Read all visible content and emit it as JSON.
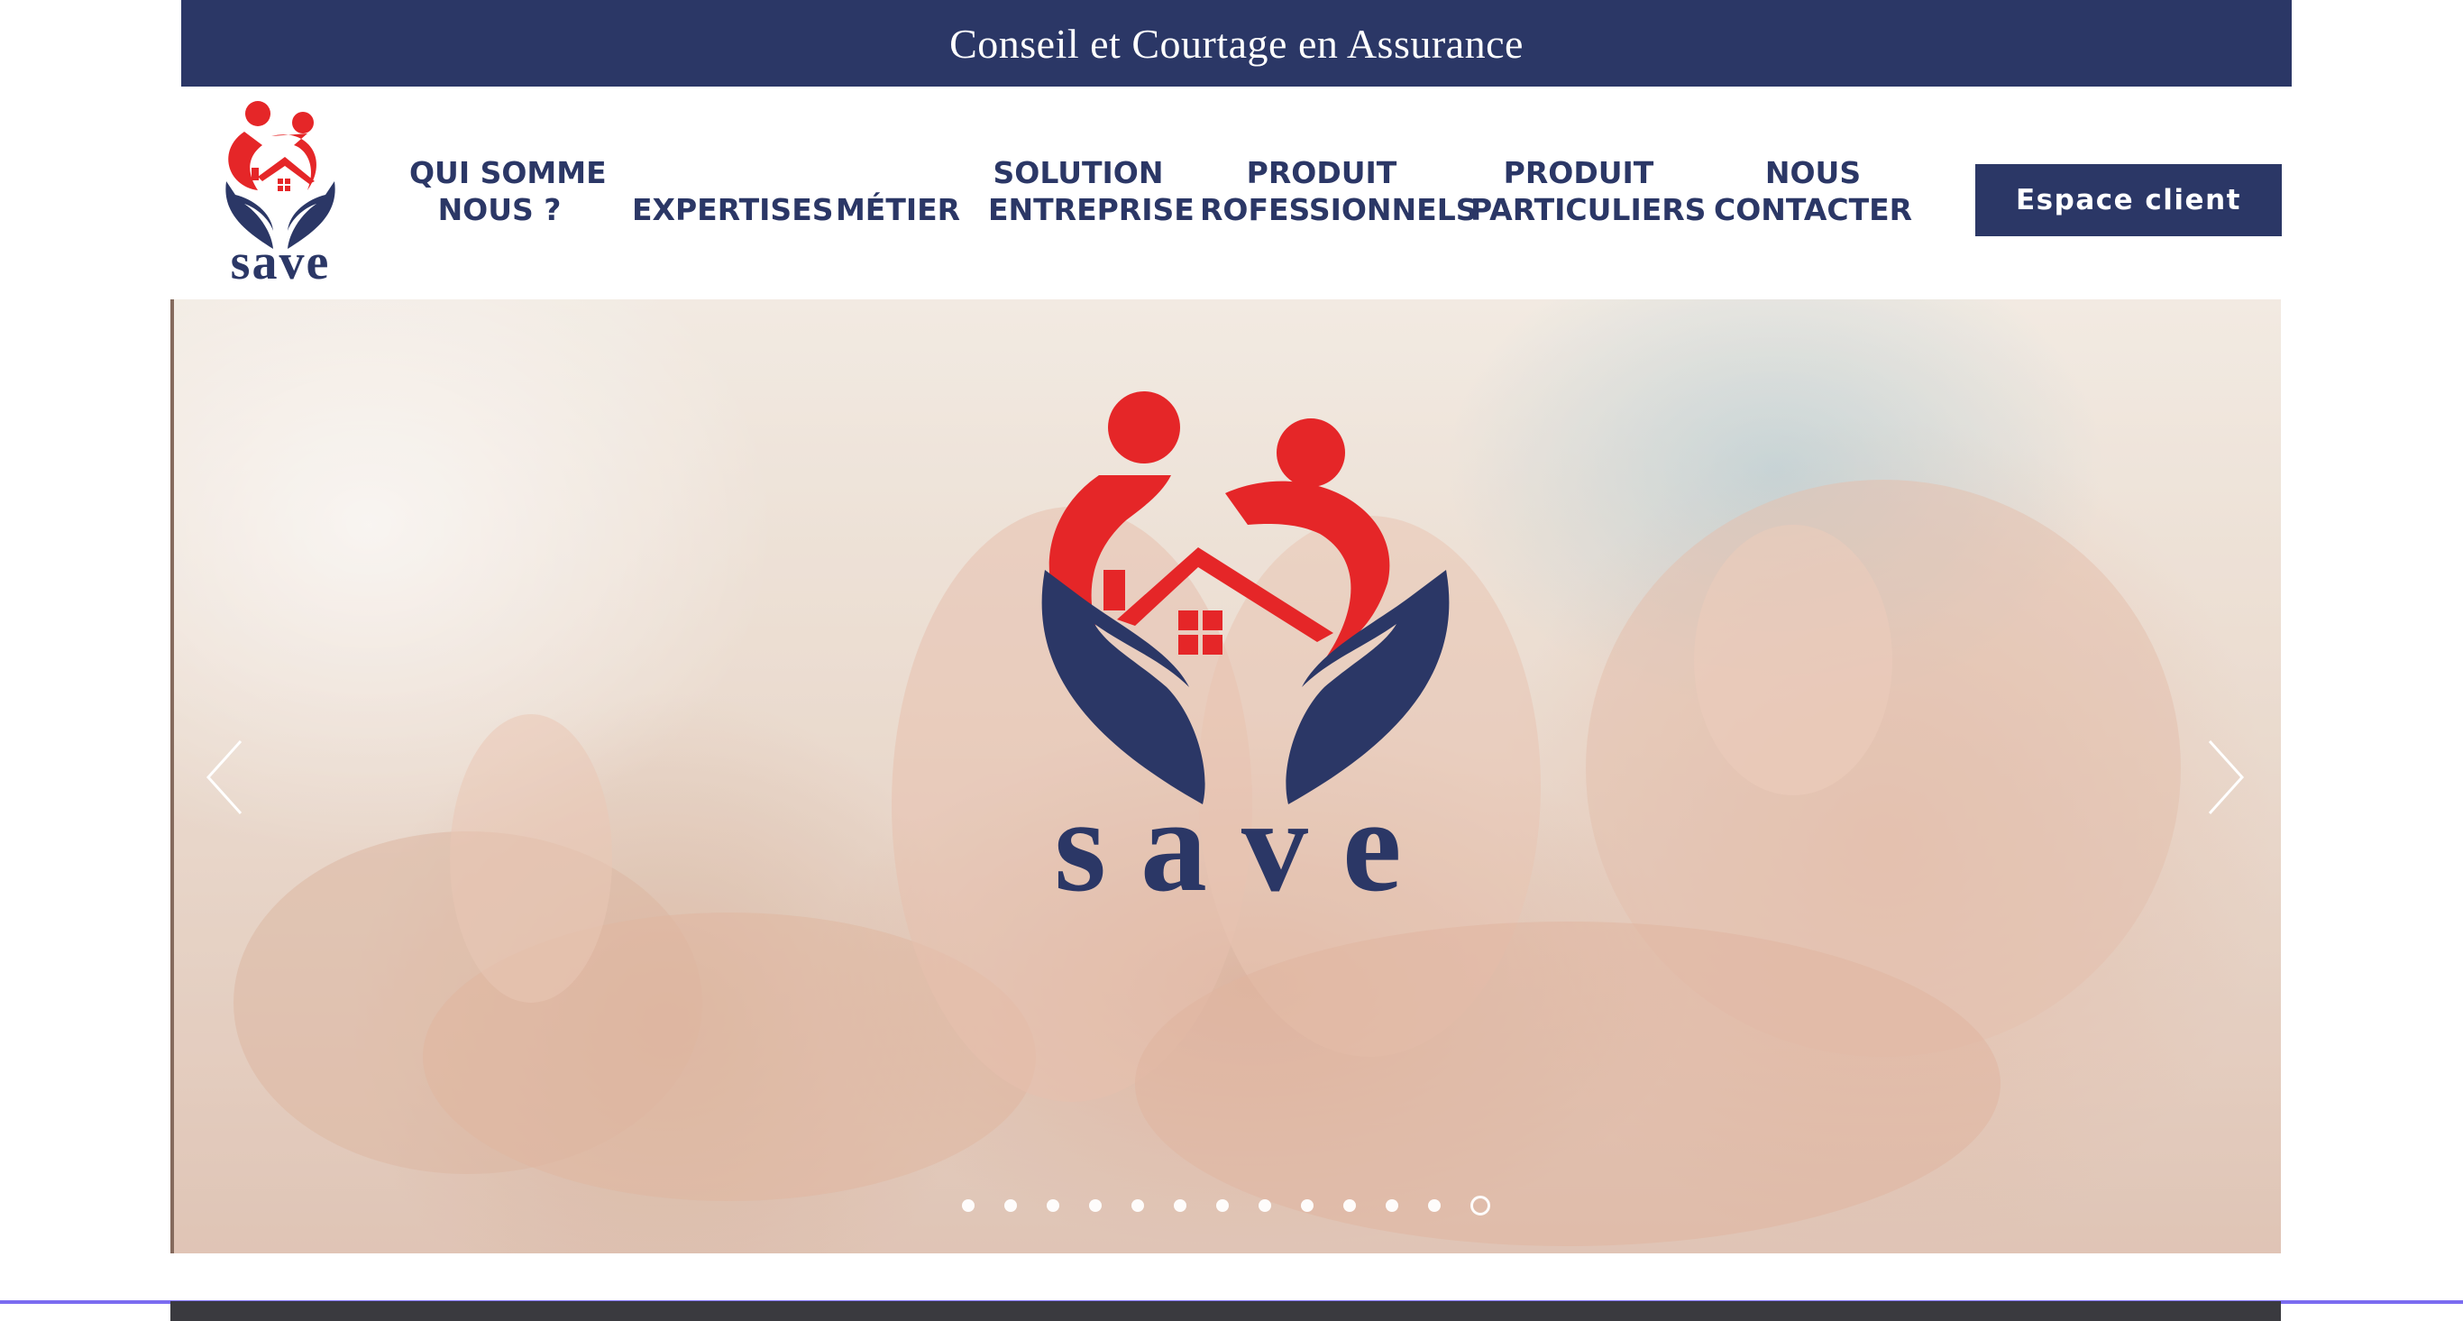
{
  "banner": {
    "text": "Conseil et Courtage en Assurance"
  },
  "brand": {
    "name": "save",
    "primary_color": "#2b3766",
    "accent_color": "#e52628"
  },
  "nav": {
    "items": [
      {
        "line1": "QUI SOMME",
        "line2": "NOUS ?"
      },
      {
        "line1": "",
        "line2": "EXPERTISES"
      },
      {
        "line1": "",
        "line2": "MÉTIER"
      },
      {
        "line1": "SOLUTION",
        "line2": "ENTREPRISE"
      },
      {
        "line1": "PRODUIT",
        "line2": "ROFESSIONNELS"
      },
      {
        "line1": "PRODUIT",
        "line2": "PARTICULIERS"
      },
      {
        "line1": "NOUS",
        "line2": "CONTACTER"
      }
    ],
    "cta_label": "Espace client"
  },
  "slider": {
    "prev_icon": "chevron-left-icon",
    "next_icon": "chevron-right-icon",
    "slide_count": 13,
    "active_slide": 13,
    "hero_logo_text": "save"
  }
}
